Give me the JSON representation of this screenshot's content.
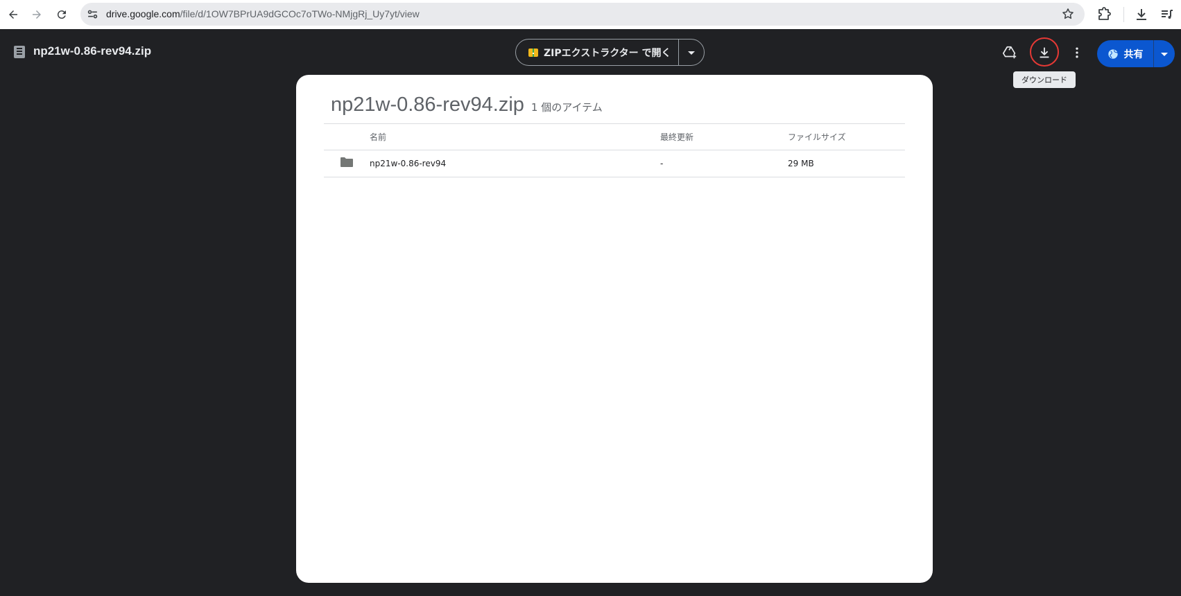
{
  "browser": {
    "url_host": "drive.google.com",
    "url_path": "/file/d/1OW7BPrUA9dGCOc7oTWo-NMjgRj_Uy7yt/view"
  },
  "viewer": {
    "file_title": "np21w-0.86-rev94.zip",
    "open_with_label": "ZIPエクストラクター で開く",
    "tooltip": "ダウンロード",
    "share_label": "共有"
  },
  "zip_panel": {
    "title": "np21w-0.86-rev94.zip",
    "item_count": "1 個のアイテム",
    "columns": {
      "name": "名前",
      "modified": "最終更新",
      "size": "ファイルサイズ"
    },
    "rows": [
      {
        "name": "np21w-0.86-rev94",
        "modified": "-",
        "size": "29 MB"
      }
    ]
  },
  "colors": {
    "background": "#202124",
    "share_button": "#0b57d0",
    "highlight_ring": "#e53935"
  }
}
